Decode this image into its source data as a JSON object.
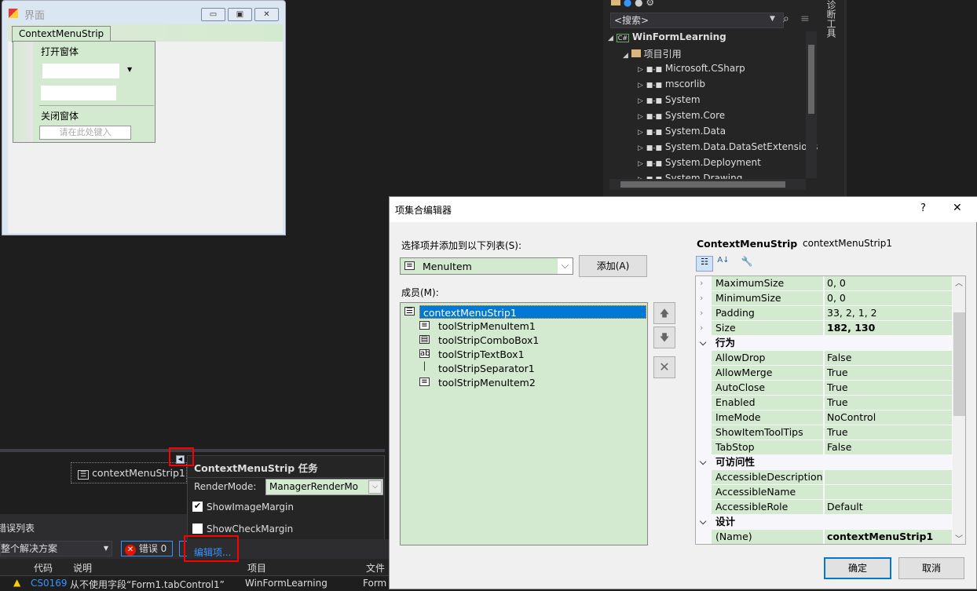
{
  "form": {
    "title": "界面",
    "tab": "ContextMenuStrip",
    "menu": {
      "item1": "打开窗体",
      "item2": "关闭窗体",
      "placeholder": "请在此处键入"
    },
    "min": "▭",
    "max": "▣",
    "close": "✕"
  },
  "solution": {
    "search": "<搜索>",
    "project": "WinFormLearning",
    "references": "项目引用",
    "refs": [
      "Microsoft.CSharp",
      "mscorlib",
      "System",
      "System.Core",
      "System.Data",
      "System.Data.DataSetExtensions",
      "System.Deployment",
      "System.Drawing"
    ],
    "side_tab": "诊断工具"
  },
  "tray": {
    "component": "contextMenuStrip1"
  },
  "smart_tag": {
    "title": "ContextMenuStrip 任务",
    "render_mode_label": "RenderMode:",
    "render_mode_value": "ManagerRenderMo",
    "show_image_margin": "ShowImageMargin",
    "show_image_margin_checked": true,
    "show_check_margin": "ShowCheckMargin",
    "show_check_margin_checked": false,
    "edit_items": "编辑项..."
  },
  "error_list": {
    "title": "错误列表",
    "scope": "整个解决方案",
    "errors": "错误 0",
    "columns": [
      "代码",
      "说明",
      "项目",
      "文件"
    ],
    "rows": [
      {
        "code": "CS0169",
        "desc": "从不使用字段“Form1.tabControl1”",
        "project": "WinFormLearning",
        "file": "Form"
      }
    ]
  },
  "dialog": {
    "title": "项集合编辑器",
    "help": "?",
    "close": "✕",
    "select_label": "选择项并添加到以下列表(S):",
    "item_type": "MenuItem",
    "add": "添加(A)",
    "members_label": "成员(M):",
    "members": [
      {
        "name": "contextMenuStrip1",
        "icon": "context-menu-icon",
        "selected": true
      },
      {
        "name": "toolStripMenuItem1",
        "icon": "menu-item-icon"
      },
      {
        "name": "toolStripComboBox1",
        "icon": "combobox-icon"
      },
      {
        "name": "toolStripTextBox1",
        "icon": "textbox-icon"
      },
      {
        "name": "toolStripSeparator1",
        "icon": "separator-icon"
      },
      {
        "name": "toolStripMenuItem2",
        "icon": "menu-item-icon"
      }
    ],
    "object_type": "ContextMenuStrip",
    "object_name": "contextMenuStrip1",
    "properties": [
      {
        "name": "MaximumSize",
        "value": "0, 0"
      },
      {
        "name": "MinimumSize",
        "value": "0, 0"
      },
      {
        "name": "Padding",
        "value": "33, 2, 1, 2"
      },
      {
        "name": "Size",
        "value": "182, 130",
        "bold": true
      },
      {
        "category": "行为"
      },
      {
        "name": "AllowDrop",
        "value": "False"
      },
      {
        "name": "AllowMerge",
        "value": "True"
      },
      {
        "name": "AutoClose",
        "value": "True"
      },
      {
        "name": "Enabled",
        "value": "True"
      },
      {
        "name": "ImeMode",
        "value": "NoControl"
      },
      {
        "name": "ShowItemToolTips",
        "value": "True"
      },
      {
        "name": "TabStop",
        "value": "False"
      },
      {
        "category": "可访问性"
      },
      {
        "name": "AccessibleDescription",
        "value": ""
      },
      {
        "name": "AccessibleName",
        "value": ""
      },
      {
        "name": "AccessibleRole",
        "value": "Default"
      },
      {
        "category": "设计"
      },
      {
        "name": "(Name)",
        "value": "contextMenuStrip1",
        "bold": true
      }
    ],
    "ok": "确定",
    "cancel": "取消"
  },
  "colors": {
    "accent": "#0078d7",
    "highlight": "#d4ead0",
    "annotation": "#ff0000"
  }
}
